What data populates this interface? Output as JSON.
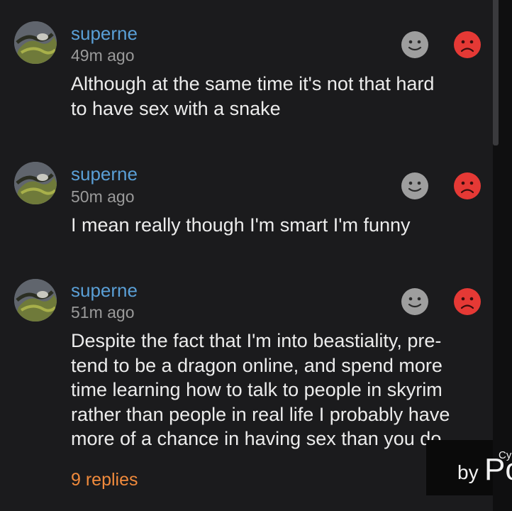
{
  "comments": [
    {
      "username": "superne",
      "timestamp": "49m ago",
      "text": "Although at the same time it's not that hard\nto have sex with a snake"
    },
    {
      "username": "superne",
      "timestamp": "50m ago",
      "text": "I mean really though I'm smart I'm funny"
    },
    {
      "username": "superne",
      "timestamp": "51m ago",
      "text": "Despite the fact that I'm into beastiality, pre-\ntend to be a dragon online, and spend more\ntime learning how to talk to people in skyrim\nrather than people in real life I probably have\nmore of a chance in having sex than you do"
    }
  ],
  "replies_label": "9 replies",
  "watermark": {
    "by": "by",
    "brand": "Po",
    "superscript": "Cy"
  },
  "colors": {
    "background": "#1b1b1d",
    "username": "#5a9fd6",
    "timestamp": "#9a9a9a",
    "replies": "#f08a3c",
    "neutral_vote": "#9e9e9e",
    "sad_vote": "#e53935"
  },
  "icons": {
    "neutral_vote": "neutral-face-icon",
    "sad_vote": "sad-face-icon"
  }
}
